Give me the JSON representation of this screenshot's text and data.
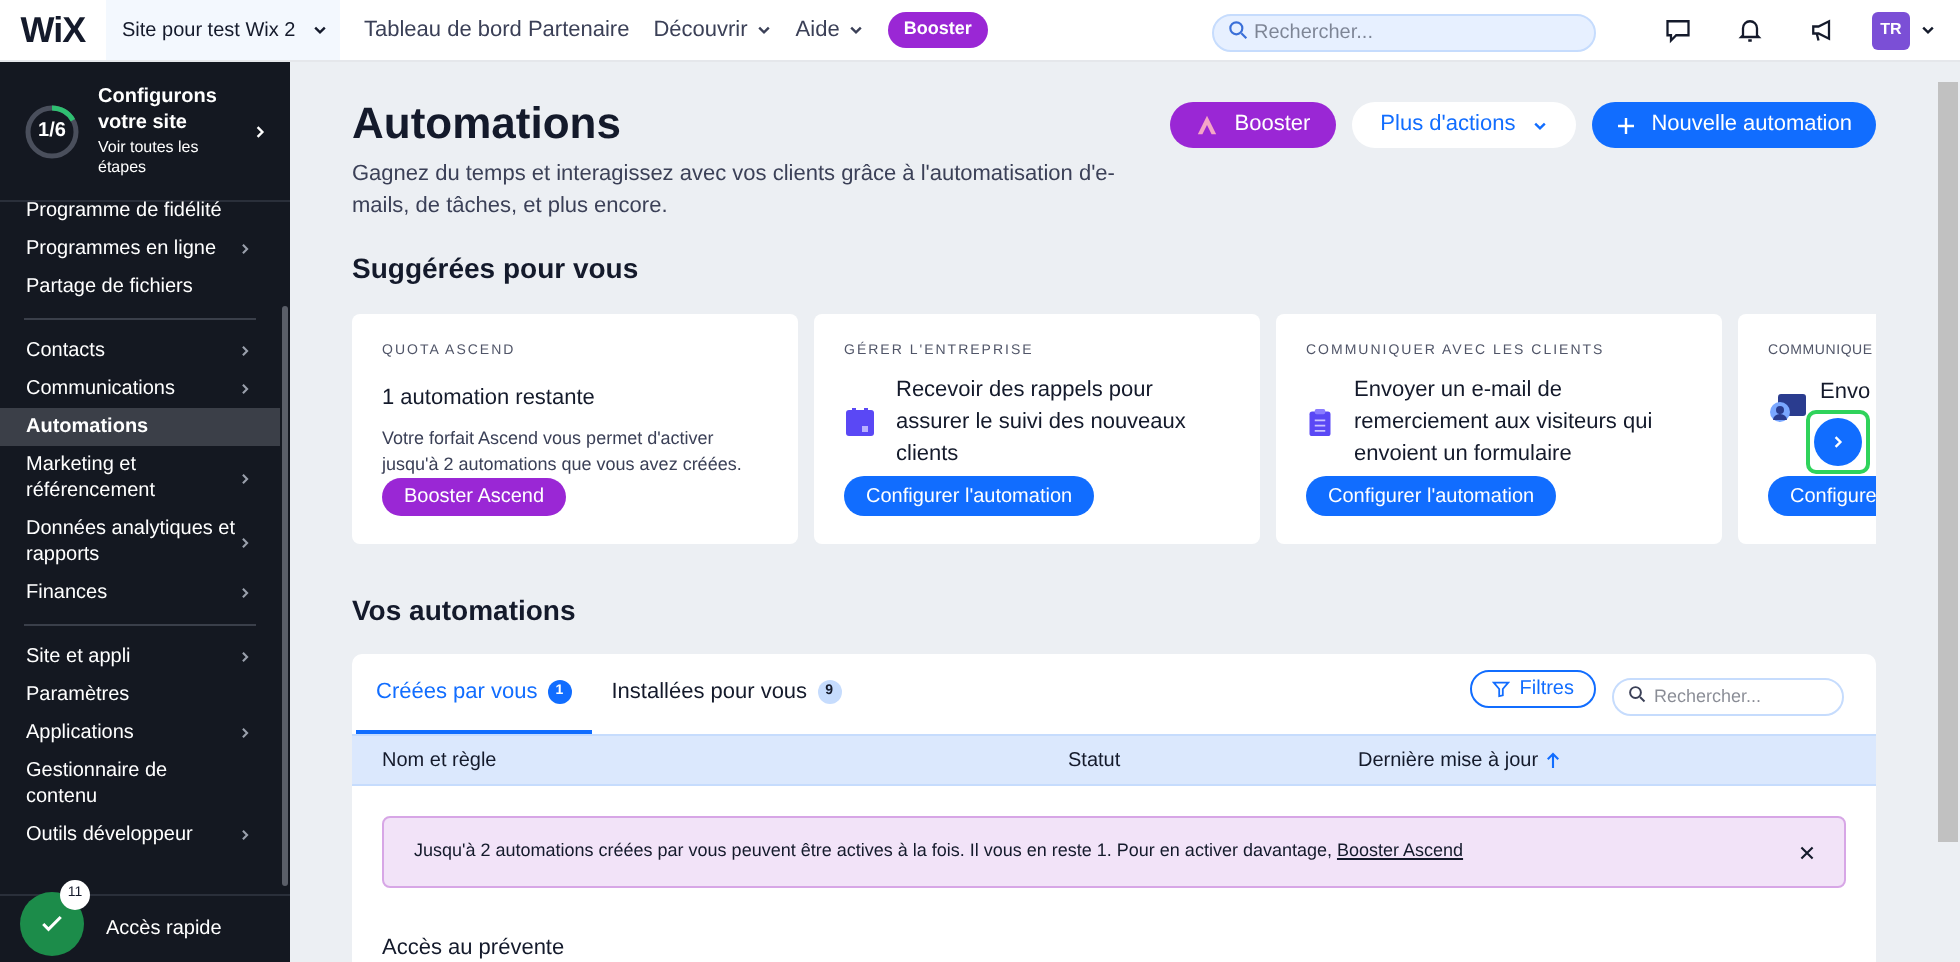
{
  "topbar": {
    "logo": "WiX",
    "site": "Site pour test Wix 2",
    "nav": [
      {
        "label": "Tableau de bord Partenaire",
        "dropdown": false
      },
      {
        "label": "Découvrir",
        "dropdown": true
      },
      {
        "label": "Aide",
        "dropdown": true
      }
    ],
    "badge": "Booster",
    "search": {
      "placeholder": "Rechercher..."
    },
    "avatar": "TR"
  },
  "sidebar": {
    "setup": {
      "progress": "1/6",
      "level": 0.1667,
      "title": "Configurons votre site",
      "link": "Voir toutes les étapes"
    },
    "groups": [
      [
        {
          "label": "Programme de fidélité",
          "submenu": false,
          "selected": false
        },
        {
          "label": "Programmes en ligne",
          "submenu": true,
          "selected": false
        },
        {
          "label": "Partage de fichiers",
          "submenu": false,
          "selected": false
        }
      ],
      [
        {
          "label": "Contacts",
          "submenu": true,
          "selected": false
        },
        {
          "label": "Communications",
          "submenu": true,
          "selected": false
        },
        {
          "label": "Automations",
          "submenu": false,
          "selected": true
        },
        {
          "label": "Marketing et référencement",
          "submenu": true,
          "selected": false
        },
        {
          "label": "Données analytiques et rapports",
          "submenu": true,
          "selected": false
        },
        {
          "label": "Finances",
          "submenu": true,
          "selected": false
        }
      ],
      [
        {
          "label": "Site et appli",
          "submenu": true,
          "selected": false
        },
        {
          "label": "Paramètres",
          "submenu": false,
          "selected": false
        },
        {
          "label": "Applications",
          "submenu": true,
          "selected": false
        },
        {
          "label": "Gestionnaire de contenu",
          "submenu": false,
          "selected": false
        },
        {
          "label": "Outils développeur",
          "submenu": true,
          "selected": false
        }
      ]
    ],
    "quick_access": {
      "label": "Accès rapide",
      "badge": "11"
    }
  },
  "header": {
    "title": "Automations",
    "description": "Gagnez du temps et interagissez avec vos clients grâce à l'automatisation d'e-mails, de tâches, et plus encore.",
    "buttons": [
      {
        "kind": "booster",
        "label": "Booster"
      },
      {
        "kind": "dropdown",
        "label": "Plus d'actions"
      },
      {
        "kind": "primary",
        "label": "Nouvelle automation"
      }
    ]
  },
  "suggested": {
    "title": "Suggérées pour vous",
    "cards": [
      {
        "kind": "quota",
        "category": "QUOTA ASCEND",
        "title": "1 automation restante",
        "description": "Votre forfait Ascend vous permet d'activer jusqu'à 2 automations que vous avez créées.",
        "button": "Booster Ascend"
      },
      {
        "kind": "calendar",
        "category": "GÉRER L'ENTREPRISE",
        "title": "Recevoir des rappels pour assurer le suivi des nouveaux clients",
        "button": "Configurer l'automation"
      },
      {
        "kind": "form",
        "category": "COMMUNIQUER AVEC LES CLIENTS",
        "title": "Envoyer un e-mail de remerciement aux visiteurs qui envoient un formulaire",
        "button": "Configurer l'automation"
      },
      {
        "kind": "contact",
        "category": "COMMUNIQUE",
        "title": "Envo",
        "button": "Configure"
      }
    ]
  },
  "automations": {
    "title": "Vos automations",
    "tabs": [
      {
        "label": "Créées par vous",
        "count": "1",
        "selected": true
      },
      {
        "label": "Installées pour vous",
        "count": "9",
        "selected": false
      }
    ],
    "filter": "Filtres",
    "search": {
      "placeholder": "Rechercher..."
    },
    "columns": [
      {
        "label": "Nom et règle",
        "sorted": false
      },
      {
        "label": "Statut",
        "sorted": false
      },
      {
        "label": "Dernière mise à jour",
        "sorted": true
      }
    ],
    "banner": {
      "text": "Jusqu'à 2 automations créées par vous peuvent être actives à la fois. Il vous en reste 1. Pour en activer davantage,",
      "link": "Booster Ascend"
    },
    "section": "Accès au prévente"
  }
}
